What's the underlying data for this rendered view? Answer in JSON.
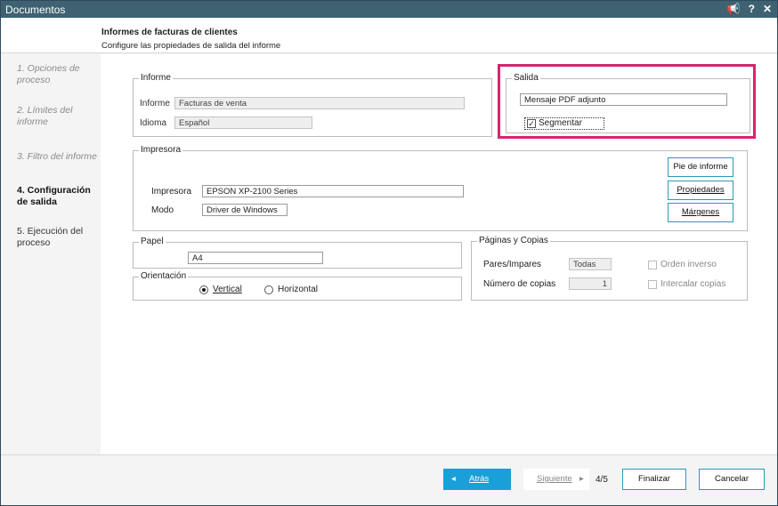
{
  "window": {
    "title": "Documentos",
    "ctrl_pin": "📢",
    "ctrl_help": "?",
    "ctrl_close": "✕"
  },
  "header": {
    "title": "Informes de facturas de clientes",
    "subtitle": "Configure las propiedades de salida del informe"
  },
  "steps": [
    {
      "label": "1. Opciones de proceso"
    },
    {
      "label": "2. Límites del informe"
    },
    {
      "label": "3. Filtro del informe"
    },
    {
      "label": "4. Configuración de salida"
    },
    {
      "label": "5. Ejecución del proceso"
    }
  ],
  "informe": {
    "legend": "Informe",
    "informe_label": "Informe",
    "informe_value": "Facturas de venta",
    "idioma_label": "Idioma",
    "idioma_value": "Español"
  },
  "salida": {
    "legend": "Salida",
    "value": "Mensaje PDF adjunto",
    "segmentar_label": "Segmentar",
    "segmentar_checked": "✓"
  },
  "impresora": {
    "legend": "Impresora",
    "impresora_label": "Impresora",
    "impresora_value": "EPSON XP-2100 Series",
    "modo_label": "Modo",
    "modo_value": "Driver de Windows",
    "btn_pie": "Pie de informe",
    "btn_propiedades": "Propiedades",
    "btn_margenes": "Márgenes"
  },
  "papel": {
    "legend": "Papel",
    "value": "A4"
  },
  "orientacion": {
    "legend": "Orientación",
    "vertical": "Vertical",
    "horizontal": "Horizontal"
  },
  "paginas": {
    "legend": "Páginas y Copias",
    "pares_label": "Pares/Impares",
    "pares_value": "Todas",
    "copias_label": "Número de copias",
    "copias_value": "1",
    "orden_inverso": "Orden inverso",
    "intercalar": "Intercalar copias"
  },
  "footer": {
    "back_arrow": "◂",
    "back": "Atrás",
    "next": "Siguiente",
    "next_arrow": "▸",
    "pager": "4/5",
    "finish": "Finalizar",
    "cancel": "Cancelar"
  },
  "colors": {
    "titlebar": "#3f6272",
    "accent": "#1aa0d8",
    "highlight": "#d9246f"
  }
}
